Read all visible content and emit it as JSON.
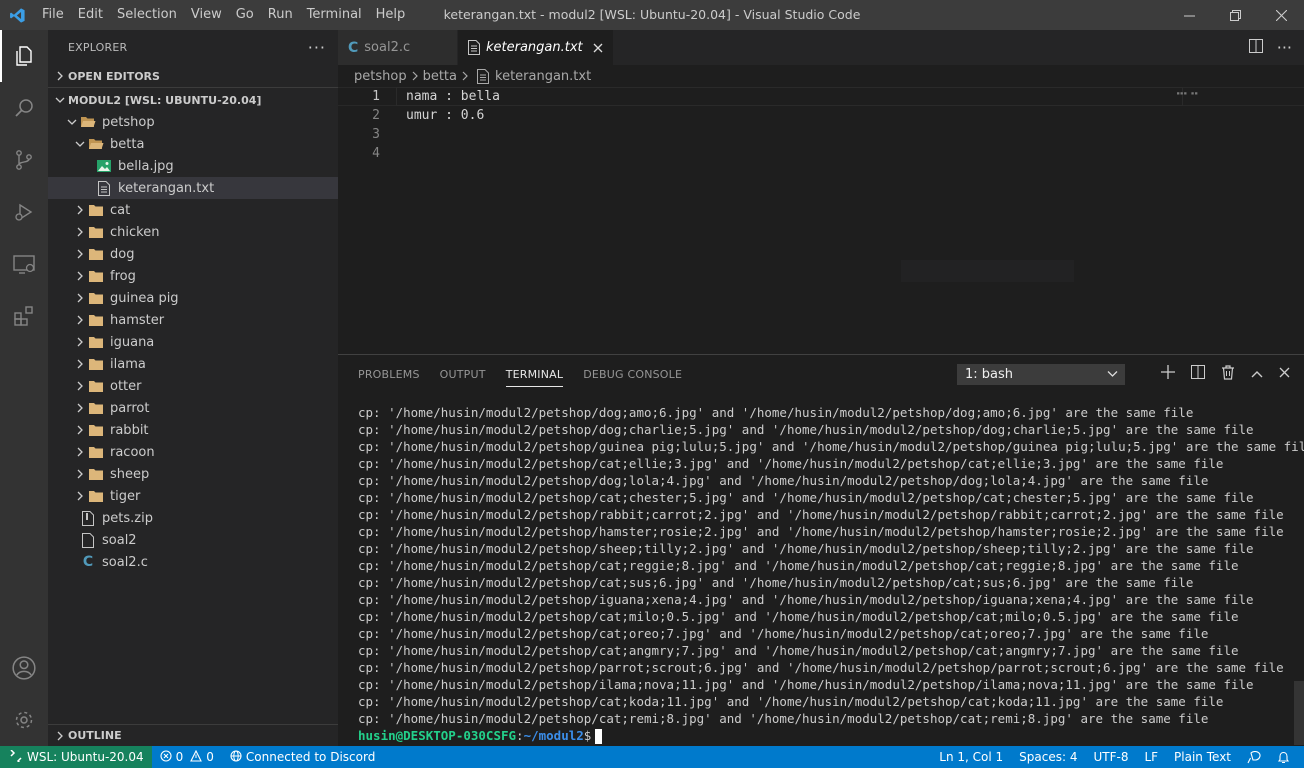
{
  "window": {
    "title": "keterangan.txt - modul2 [WSL: Ubuntu-20.04] - Visual Studio Code",
    "menu": [
      "File",
      "Edit",
      "Selection",
      "View",
      "Go",
      "Run",
      "Terminal",
      "Help"
    ]
  },
  "sidebar": {
    "title": "EXPLORER",
    "open_editors": "OPEN EDITORS",
    "workspace": "MODUL2 [WSL: UBUNTU-20.04]",
    "outline": "OUTLINE",
    "tree": {
      "petshop": "petshop",
      "betta": "betta",
      "bella": "bella.jpg",
      "keterangan": "keterangan.txt",
      "folders": [
        "cat",
        "chicken",
        "dog",
        "frog",
        "guinea pig",
        "hamster",
        "iguana",
        "ilama",
        "otter",
        "parrot",
        "rabbit",
        "racoon",
        "sheep",
        "tiger"
      ],
      "pets_zip": "pets.zip",
      "soal2": "soal2",
      "soal2_c": "soal2.c"
    }
  },
  "tabs": [
    {
      "label": "soal2.c"
    },
    {
      "label": "keterangan.txt"
    }
  ],
  "breadcrumb": [
    "petshop",
    "betta",
    "keterangan.txt"
  ],
  "editor": {
    "line_numbers": [
      "1",
      "2",
      "3",
      "4"
    ],
    "lines": [
      "nama : bella",
      "umur : 0.6",
      "",
      ""
    ]
  },
  "panel": {
    "tabs": [
      "PROBLEMS",
      "OUTPUT",
      "TERMINAL",
      "DEBUG CONSOLE"
    ],
    "terminal_select": "1: bash",
    "terminal_lines": [
      "cp: '/home/husin/modul2/petshop/dog;amo;6.jpg' and '/home/husin/modul2/petshop/dog;amo;6.jpg' are the same file",
      "cp: '/home/husin/modul2/petshop/dog;charlie;5.jpg' and '/home/husin/modul2/petshop/dog;charlie;5.jpg' are the same file",
      "cp: '/home/husin/modul2/petshop/guinea pig;lulu;5.jpg' and '/home/husin/modul2/petshop/guinea pig;lulu;5.jpg' are the same file",
      "cp: '/home/husin/modul2/petshop/cat;ellie;3.jpg' and '/home/husin/modul2/petshop/cat;ellie;3.jpg' are the same file",
      "cp: '/home/husin/modul2/petshop/dog;lola;4.jpg' and '/home/husin/modul2/petshop/dog;lola;4.jpg' are the same file",
      "cp: '/home/husin/modul2/petshop/cat;chester;5.jpg' and '/home/husin/modul2/petshop/cat;chester;5.jpg' are the same file",
      "cp: '/home/husin/modul2/petshop/rabbit;carrot;2.jpg' and '/home/husin/modul2/petshop/rabbit;carrot;2.jpg' are the same file",
      "cp: '/home/husin/modul2/petshop/hamster;rosie;2.jpg' and '/home/husin/modul2/petshop/hamster;rosie;2.jpg' are the same file",
      "cp: '/home/husin/modul2/petshop/sheep;tilly;2.jpg' and '/home/husin/modul2/petshop/sheep;tilly;2.jpg' are the same file",
      "cp: '/home/husin/modul2/petshop/cat;reggie;8.jpg' and '/home/husin/modul2/petshop/cat;reggie;8.jpg' are the same file",
      "cp: '/home/husin/modul2/petshop/cat;sus;6.jpg' and '/home/husin/modul2/petshop/cat;sus;6.jpg' are the same file",
      "cp: '/home/husin/modul2/petshop/iguana;xena;4.jpg' and '/home/husin/modul2/petshop/iguana;xena;4.jpg' are the same file",
      "cp: '/home/husin/modul2/petshop/cat;milo;0.5.jpg' and '/home/husin/modul2/petshop/cat;milo;0.5.jpg' are the same file",
      "cp: '/home/husin/modul2/petshop/cat;oreo;7.jpg' and '/home/husin/modul2/petshop/cat;oreo;7.jpg' are the same file",
      "cp: '/home/husin/modul2/petshop/cat;angmry;7.jpg' and '/home/husin/modul2/petshop/cat;angmry;7.jpg' are the same file",
      "cp: '/home/husin/modul2/petshop/parrot;scrout;6.jpg' and '/home/husin/modul2/petshop/parrot;scrout;6.jpg' are the same file",
      "cp: '/home/husin/modul2/petshop/ilama;nova;11.jpg' and '/home/husin/modul2/petshop/ilama;nova;11.jpg' are the same file",
      "cp: '/home/husin/modul2/petshop/cat;koda;11.jpg' and '/home/husin/modul2/petshop/cat;koda;11.jpg' are the same file",
      "cp: '/home/husin/modul2/petshop/cat;remi;8.jpg' and '/home/husin/modul2/petshop/cat;remi;8.jpg' are the same file"
    ],
    "prompt_user": "husin@DESKTOP-030CSFG",
    "prompt_sep": ":",
    "prompt_path": "~/modul2",
    "prompt_end": "$"
  },
  "statusbar": {
    "remote": "WSL: Ubuntu-20.04",
    "errors": "0",
    "warnings": "0",
    "discord": "Connected to Discord",
    "position": "Ln 1, Col 1",
    "spaces": "Spaces: 4",
    "encoding": "UTF-8",
    "eol": "LF",
    "language": "Plain Text"
  },
  "colors": {
    "statusbar": "#007acc",
    "remote": "#16825d",
    "folder": "#dcb67a",
    "c_file": "#519aba"
  }
}
